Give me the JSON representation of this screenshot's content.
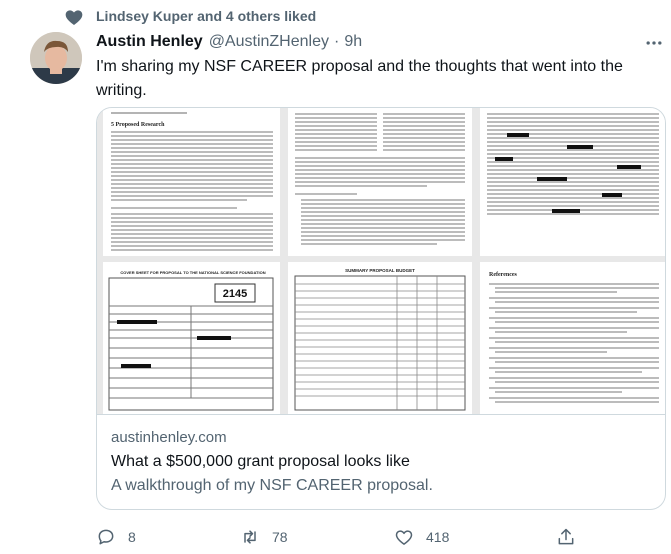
{
  "social_context": {
    "text": "Lindsey Kuper and 4 others liked",
    "icon": "heart-icon"
  },
  "author": {
    "name": "Austin Henley",
    "handle": "@AustinZHenley",
    "separator": "·",
    "time": "9h"
  },
  "tweet": {
    "text": "I'm sharing my NSF CAREER proposal and the thoughts that went into the writing."
  },
  "card": {
    "domain": "austinhenley.com",
    "title": "What a $500,000 grant proposal looks like",
    "description": "A walkthrough of my NSF CAREER proposal.",
    "form_number": "2145",
    "form_title": "COVER SHEET FOR PROPOSAL TO THE NATIONAL SCIENCE FOUNDATION",
    "budget_title": "SUMMARY PROPOSAL BUDGET",
    "references_heading": "References",
    "section_heading": "5  Proposed Research"
  },
  "actions": {
    "reply": {
      "count": "8",
      "icon": "reply-icon"
    },
    "retweet": {
      "count": "78",
      "icon": "retweet-icon"
    },
    "like": {
      "count": "418",
      "icon": "heart-outline-icon"
    },
    "share": {
      "icon": "share-icon"
    }
  },
  "colors": {
    "secondary_text": "#536471",
    "primary_text": "#0f1419",
    "border": "#cfd9de"
  }
}
